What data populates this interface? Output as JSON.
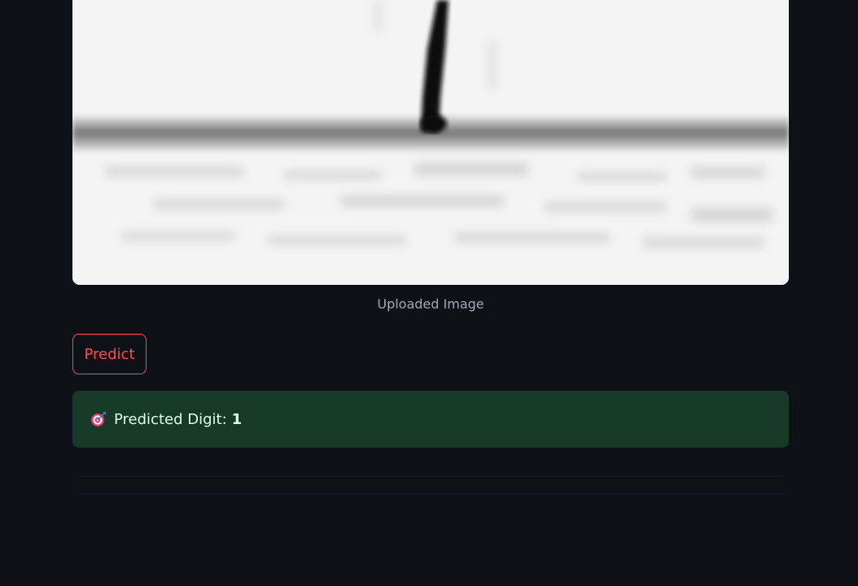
{
  "image": {
    "caption": "Uploaded Image"
  },
  "actions": {
    "predict_label": "Predict"
  },
  "result": {
    "icon": "target-icon",
    "label": "Predicted Digit:",
    "value": "1"
  },
  "colors": {
    "background": "#0e1117",
    "accent": "#ff4b4b",
    "success_bg": "#173928",
    "success_text": "#dffde9",
    "caption_text": "#a3a8b4"
  }
}
